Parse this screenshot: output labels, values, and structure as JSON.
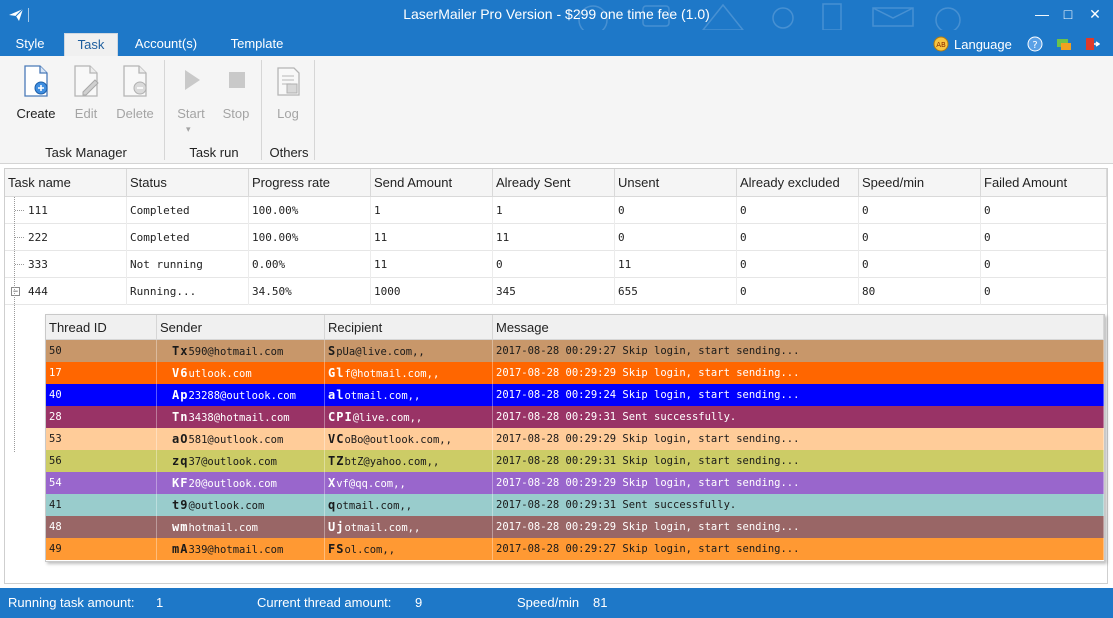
{
  "window": {
    "title": "LaserMailer Pro Version - $299 one time fee (1.0)",
    "controls": {
      "minimize": "—",
      "maximize": "□",
      "close": "✕"
    }
  },
  "menu": {
    "tabs": [
      {
        "label": "Style"
      },
      {
        "label": "Task"
      },
      {
        "label": "Account(s)"
      },
      {
        "label": "Template"
      }
    ],
    "active_tab": "Task",
    "language_label": "Language"
  },
  "ribbon": {
    "buttons": {
      "create": "Create",
      "edit": "Edit",
      "delete": "Delete",
      "start": "Start",
      "stop": "Stop",
      "log": "Log"
    },
    "groups": {
      "task_manager": "Task Manager",
      "task_run": "Task run",
      "others": "Others"
    }
  },
  "tasks": {
    "columns": [
      "Task name",
      "Status",
      "Progress rate",
      "Send Amount",
      "Already Sent",
      "Unsent",
      "Already excluded",
      "Speed/min",
      "Failed Amount"
    ],
    "rows": [
      [
        "111",
        "Completed",
        "100.00%",
        "1",
        "1",
        "0",
        "0",
        "0",
        "0"
      ],
      [
        "222",
        "Completed",
        "100.00%",
        "11",
        "11",
        "0",
        "0",
        "0",
        "0"
      ],
      [
        "333",
        "Not running",
        "0.00%",
        "11",
        "0",
        "11",
        "0",
        "0",
        "0"
      ],
      [
        "444",
        "Running...",
        "34.50%",
        "1000",
        "345",
        "655",
        "0",
        "80",
        "0"
      ]
    ]
  },
  "threads": {
    "columns": [
      "Thread ID",
      "Sender",
      "Recipient",
      "Message"
    ],
    "rows": [
      {
        "id": "50",
        "sender_prefix": "Tx",
        "sender": "590@hotmail.com",
        "recipient_prefix": "S",
        "recipient": "pUa@live.com,,",
        "message": "2017-08-28 00:29:27 Skip login, start sending...",
        "color": "#c8976a",
        "text_color": "#1a1a1a"
      },
      {
        "id": "17",
        "sender_prefix": "V6",
        "sender": "utlook.com",
        "recipient_prefix": "Gl",
        "recipient": "f@hotmail.com,,",
        "message": "2017-08-28 00:29:29 Skip login, start sending...",
        "color": "#ff6600",
        "text_color": "#ffffff"
      },
      {
        "id": "40",
        "sender_prefix": "Ap",
        "sender": "23288@outlook.com",
        "recipient_prefix": "al",
        "recipient": "otmail.com,,",
        "message": "2017-08-28 00:29:24 Skip login, start sending...",
        "color": "#0000ff",
        "text_color": "#ffffff"
      },
      {
        "id": "28",
        "sender_prefix": "Tn",
        "sender": "3438@hotmail.com",
        "recipient_prefix": "CPI",
        "recipient": "@live.com,,",
        "message": "2017-08-28 00:29:31 Sent successfully.",
        "color": "#993366",
        "text_color": "#ffffff"
      },
      {
        "id": "53",
        "sender_prefix": "aO",
        "sender": "581@outlook.com",
        "recipient_prefix": "VC",
        "recipient": "oBo@outlook.com,,",
        "message": "2017-08-28 00:29:29 Skip login, start sending...",
        "color": "#ffcc99",
        "text_color": "#1a1a1a"
      },
      {
        "id": "56",
        "sender_prefix": "zq",
        "sender": "37@outlook.com",
        "recipient_prefix": "TZ",
        "recipient": "btZ@yahoo.com,,",
        "message": "2017-08-28 00:29:31 Skip login, start sending...",
        "color": "#cccc66",
        "text_color": "#1a1a1a"
      },
      {
        "id": "54",
        "sender_prefix": "KF",
        "sender": "20@outlook.com",
        "recipient_prefix": "X",
        "recipient": "vf@qq.com,,",
        "message": "2017-08-28 00:29:29 Skip login, start sending...",
        "color": "#9966cc",
        "text_color": "#ffffff"
      },
      {
        "id": "41",
        "sender_prefix": "t9",
        "sender": "@outlook.com",
        "recipient_prefix": "q",
        "recipient": "otmail.com,,",
        "message": "2017-08-28 00:29:31 Sent successfully.",
        "color": "#99cccc",
        "text_color": "#1a1a1a"
      },
      {
        "id": "48",
        "sender_prefix": "wm",
        "sender": "hotmail.com",
        "recipient_prefix": "Uj",
        "recipient": "otmail.com,,",
        "message": "2017-08-28 00:29:29 Skip login, start sending...",
        "color": "#996666",
        "text_color": "#ffffff"
      },
      {
        "id": "49",
        "sender_prefix": "mA",
        "sender": "339@hotmail.com",
        "recipient_prefix": "FS",
        "recipient": "ol.com,,",
        "message": "2017-08-28 00:29:27 Skip login, start sending...",
        "color": "#ff9933",
        "text_color": "#1a1a1a"
      }
    ]
  },
  "status": {
    "running_label": "Running task amount:",
    "running_value": "1",
    "threads_label": "Current thread amount:",
    "threads_value": "9",
    "speed_label": "Speed/min",
    "speed_value": "81"
  }
}
